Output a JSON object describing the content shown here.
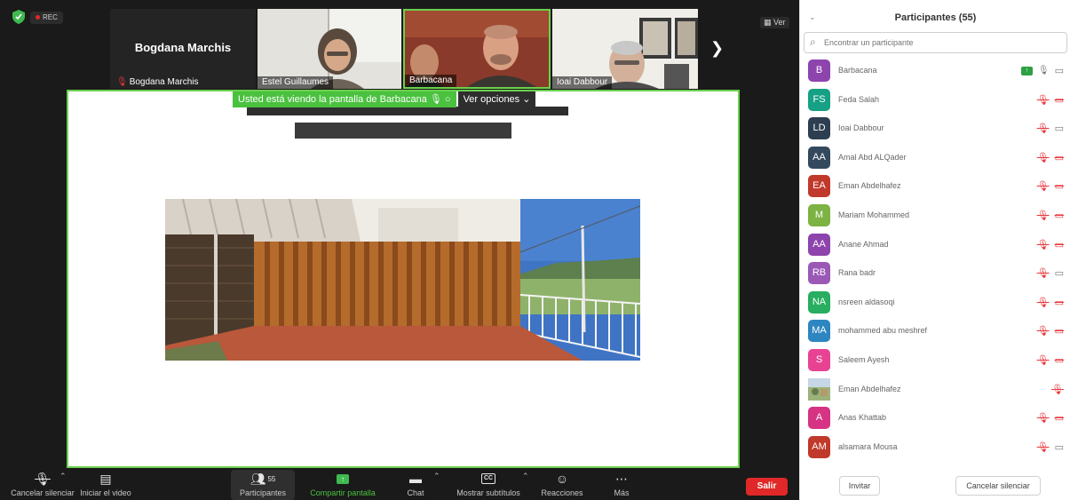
{
  "top": {
    "rec_label": "REC",
    "view_button": "Ver",
    "tiles": [
      {
        "name": "Bogdana Marchis",
        "big_name": "Bogdana Marchis"
      },
      {
        "name": "Estel Guillaumes"
      },
      {
        "name": "Barbacana"
      },
      {
        "name": "Ioai Dabbour"
      }
    ]
  },
  "share": {
    "banner_text": "Usted está viendo la pantalla de Barbacana",
    "options_label": "Ver opciones"
  },
  "toolbar": {
    "unmute_label": "Cancelar silenciar",
    "video_label": "Iniciar el video",
    "participants_label": "Participantes",
    "participants_count": "55",
    "share_label": "Compartir pantalla",
    "chat_label": "Chat",
    "subtitles_label": "Mostrar subtítulos",
    "cc_label": "CC",
    "reactions_label": "Reacciones",
    "more_label": "Más",
    "leave_label": "Salir"
  },
  "panel": {
    "title": "Participantes (55)",
    "search_placeholder": "Encontrar un participante",
    "participants": [
      {
        "initials": "B",
        "name": "Barbacana",
        "color": "#8e44ad",
        "sharing": true,
        "mic": "on",
        "cam": "on"
      },
      {
        "initials": "FS",
        "name": "Feda Salah",
        "color": "#16a085",
        "mic": "off",
        "cam": "off"
      },
      {
        "initials": "LD",
        "name": "Ioai Dabbour",
        "color": "#2c3e50",
        "mic": "off",
        "cam": "on"
      },
      {
        "initials": "AA",
        "name": "Amal Abd ALQader",
        "color": "#34495e",
        "mic": "off",
        "cam": "off"
      },
      {
        "initials": "EA",
        "name": "Eman Abdelhafez",
        "color": "#c0392b",
        "mic": "off",
        "cam": "off"
      },
      {
        "initials": "M",
        "name": "Mariam Mohammed",
        "color": "#7cb342",
        "mic": "off",
        "cam": "off"
      },
      {
        "initials": "AA",
        "name": "Anane Ahmad",
        "color": "#8e44ad",
        "mic": "off",
        "cam": "off"
      },
      {
        "initials": "RB",
        "name": "Rana badr",
        "color": "#9b59b6",
        "mic": "off",
        "cam": "on"
      },
      {
        "initials": "NA",
        "name": "nsreen aldasoqi",
        "color": "#27ae60",
        "mic": "off",
        "cam": "off"
      },
      {
        "initials": "MA",
        "name": "mohammed abu meshref",
        "color": "#2e86c1",
        "mic": "off",
        "cam": "off"
      },
      {
        "initials": "S",
        "name": "Saleem Ayesh",
        "color": "#e84393",
        "mic": "off",
        "cam": "off"
      },
      {
        "initials": "",
        "name": "Eman Abdelhafez",
        "color": "#7a8f6a",
        "photo": true,
        "mic": "off",
        "cam": "none"
      },
      {
        "initials": "A",
        "name": "Anas Khattab",
        "color": "#d63384",
        "mic": "off",
        "cam": "off"
      },
      {
        "initials": "AM",
        "name": "alsamara Mousa",
        "color": "#c0392b",
        "mic": "off",
        "cam": "on"
      }
    ],
    "invite_label": "Invitar",
    "mute_all_label": "Cancelar silenciar"
  }
}
